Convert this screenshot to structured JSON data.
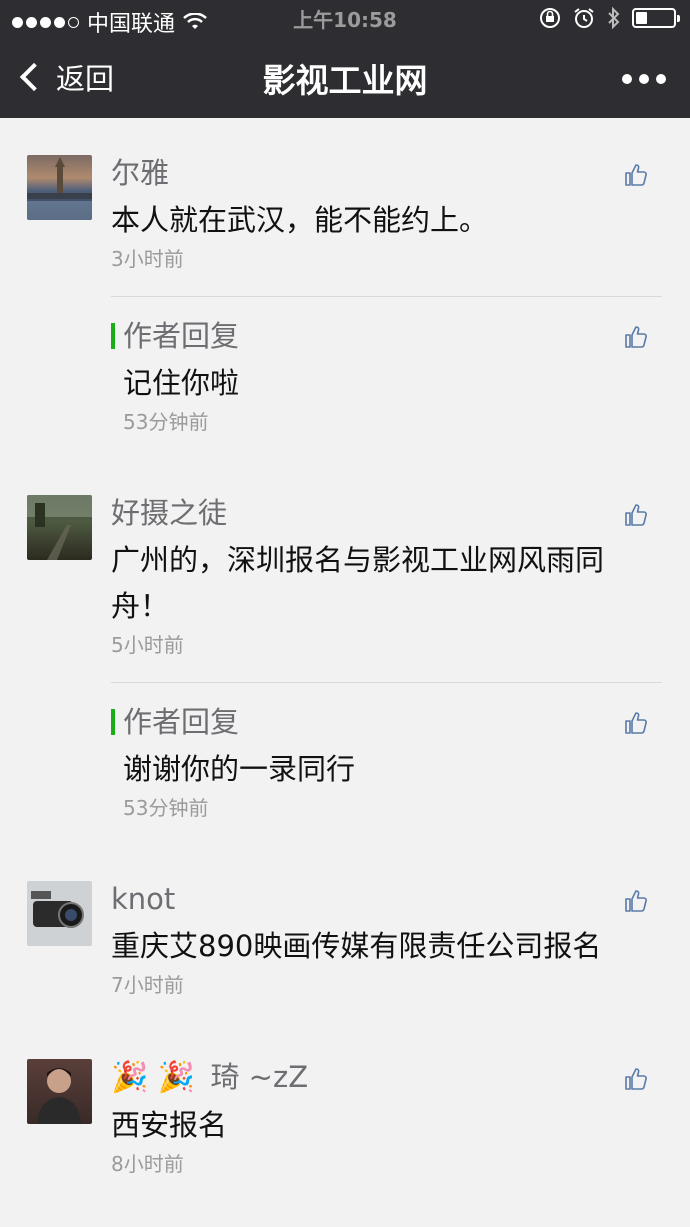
{
  "status_bar": {
    "carrier": "中国联通",
    "time": "上午10:58"
  },
  "nav": {
    "back_label": "返回",
    "title": "影视工业网"
  },
  "comments": [
    {
      "name": "尔雅",
      "text": "本人就在武汉，能不能约上。",
      "time": "3小时前",
      "reply": {
        "label": "作者回复",
        "text": "记住你啦",
        "time": "53分钟前"
      }
    },
    {
      "name": "好摄之徒",
      "text_line1": "广州的，深圳报名与影视工业网风雨同",
      "text_line2": "舟！",
      "time": "5小时前",
      "reply": {
        "label": "作者回复",
        "text": "谢谢你的一录同行",
        "time": "53分钟前"
      }
    },
    {
      "name": "knot",
      "text": "重庆艾890映画传媒有限责任公司报名",
      "time": "7小时前"
    },
    {
      "name_emoji": "🎉 🎉",
      "name": "琦 ~zZ",
      "text": "西安报名",
      "time": "8小时前"
    }
  ],
  "colors": {
    "nav_bg": "#2e2e32",
    "page_bg": "#f2f2f2",
    "reply_accent": "#1aad19",
    "like_icon": "#5a7aa8"
  }
}
